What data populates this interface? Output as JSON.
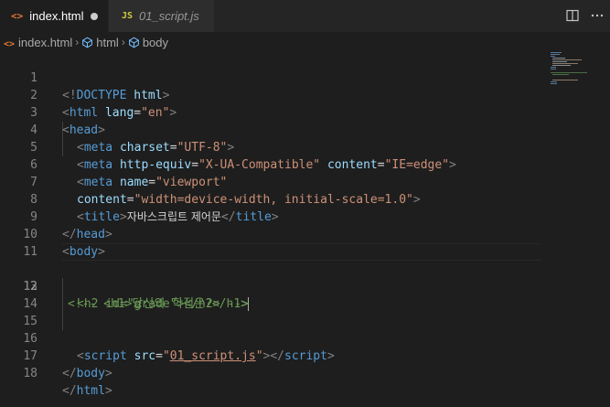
{
  "tabs": [
    {
      "icon": "<>",
      "label": "index.html",
      "active": true,
      "modified": true
    },
    {
      "icon": "JS",
      "label": "01_script.js",
      "active": false,
      "modified": false
    }
  ],
  "breadcrumb": {
    "file": "index.html",
    "items": [
      "html",
      "body"
    ]
  },
  "editor": {
    "current_line": 12,
    "line_numbers": [
      "1",
      "2",
      "3",
      "4",
      "5",
      "6",
      "7",
      "8",
      "9",
      "10",
      "11",
      "12",
      "13",
      "14",
      "15",
      "16",
      "17",
      "18"
    ]
  },
  "code": {
    "l1": {
      "open": "<!",
      "tag": "DOCTYPE",
      "sp": " ",
      "attr": "html",
      "close": ">"
    },
    "l2": {
      "open": "<",
      "tag": "html",
      "sp": " ",
      "attr": "lang",
      "eq": "=",
      "val": "\"en\"",
      "close": ">"
    },
    "l3": {
      "open": "<",
      "tag": "head",
      "close": ">"
    },
    "l4": {
      "open": "<",
      "tag": "meta",
      "sp": " ",
      "attr": "charset",
      "eq": "=",
      "val": "\"UTF-8\"",
      "close": ">"
    },
    "l5": {
      "open": "<",
      "tag": "meta",
      "sp": " ",
      "attr": "http-equiv",
      "eq": "=",
      "val": "\"X-UA-Compatible\"",
      "sp2": " ",
      "attr2": "content",
      "eq2": "=",
      "val2": "\"IE=edge\"",
      "close": ">"
    },
    "l6": {
      "open": "<",
      "tag": "meta",
      "sp": " ",
      "attr": "name",
      "eq": "=",
      "val": "\"viewport\""
    },
    "l7": {
      "attr": "content",
      "eq": "=",
      "val": "\"width=device-width, initial-scale=1.0\"",
      "close": ">"
    },
    "l8": {
      "open": "<",
      "tag": "title",
      "close": ">",
      "text": "자바스크립트 제어문",
      "open2": "</",
      "tag2": "title",
      "close2": ">"
    },
    "l9": {
      "open": "</",
      "tag": "head",
      "close": ">"
    },
    "l10": {
      "open": "<",
      "tag": "body",
      "close": ">"
    },
    "l12": {
      "comment": "<!-- <h1>당신의 학점은?</h1>"
    },
    "l13": {
      "comment": "<h2 id=\"grade\"></h2> -->"
    },
    "l16": {
      "open": "<",
      "tag": "script",
      "sp": " ",
      "attr": "src",
      "eq": "=",
      "q1": "\"",
      "link": "01_script.js",
      "q2": "\"",
      "close": ">",
      "open2": "</",
      "tag2": "script",
      "close2": ">"
    },
    "l17": {
      "open": "</",
      "tag": "body",
      "close": ">"
    },
    "l18": {
      "open": "</",
      "tag": "html",
      "close": ">"
    }
  },
  "icons": {
    "split_editor": "split-editor-icon",
    "more_actions": "more-actions-icon",
    "html_file": "html-file-icon",
    "js_file": "js-file-icon",
    "symbol": "symbol-icon"
  },
  "colors": {
    "background": "#1e1e1e",
    "tag": "#569cd6",
    "attribute": "#9cdcfe",
    "string": "#ce9178",
    "comment": "#6a9955",
    "bracket": "#808080",
    "html_icon": "#e37933",
    "js_icon": "#cbcb41"
  }
}
